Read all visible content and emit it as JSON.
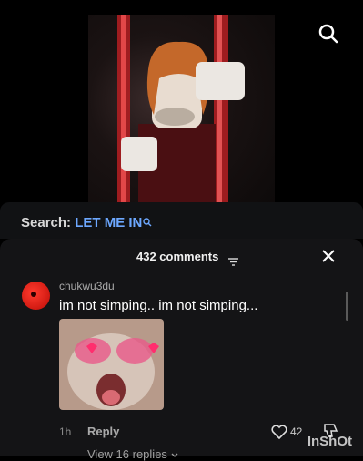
{
  "search": {
    "label": "Search:",
    "query": "LET ME IN"
  },
  "comments": {
    "count_label": "432 comments"
  },
  "comment": {
    "username": "chukwu3du",
    "text": "im not simping.. im not simping...",
    "time": "1h",
    "reply_label": "Reply",
    "likes": "42",
    "view_replies": "View 16 replies"
  },
  "watermark": "InShOt",
  "icons": {
    "search_top": "search-icon",
    "search_mini": "search-icon",
    "sort": "sort-icon",
    "close": "close-icon",
    "like": "heart-icon",
    "dislike": "thumbs-down-icon",
    "chevron": "chevron-down-icon"
  },
  "colors": {
    "query": "#6da8ff",
    "avatar": "#e0241a",
    "sheet_bg": "#141416"
  }
}
